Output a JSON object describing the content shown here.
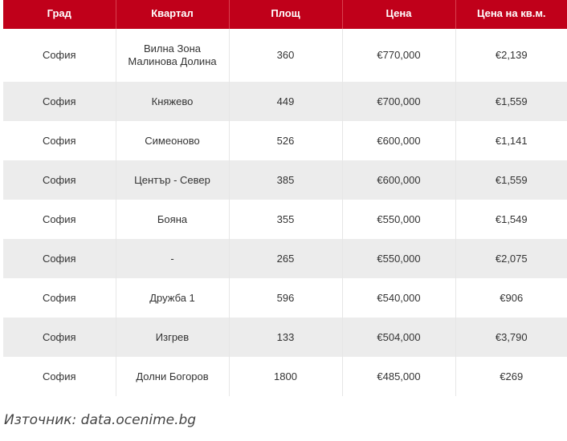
{
  "table": {
    "headers": [
      "Град",
      "Квартал",
      "Площ",
      "Цена",
      "Цена на кв.м."
    ],
    "rows": [
      [
        "София",
        "Вилна Зона Малинова Долина",
        "360",
        "€770,000",
        "€2,139"
      ],
      [
        "София",
        "Княжево",
        "449",
        "€700,000",
        "€1,559"
      ],
      [
        "София",
        "Симеоново",
        "526",
        "€600,000",
        "€1,141"
      ],
      [
        "София",
        "Център - Север",
        "385",
        "€600,000",
        "€1,559"
      ],
      [
        "София",
        "Бояна",
        "355",
        "€550,000",
        "€1,549"
      ],
      [
        "София",
        "-",
        "265",
        "€550,000",
        "€2,075"
      ],
      [
        "София",
        "Дружба 1",
        "596",
        "€540,000",
        "€906"
      ],
      [
        "София",
        "Изгрев",
        "133",
        "€504,000",
        "€3,790"
      ],
      [
        "София",
        "Долни Богоров",
        "1800",
        "€485,000",
        "€269"
      ]
    ]
  },
  "source": "Източник: data.ocenime.bg",
  "colors": {
    "header_bg": "#c0001a",
    "stripe_bg": "#ececec"
  }
}
